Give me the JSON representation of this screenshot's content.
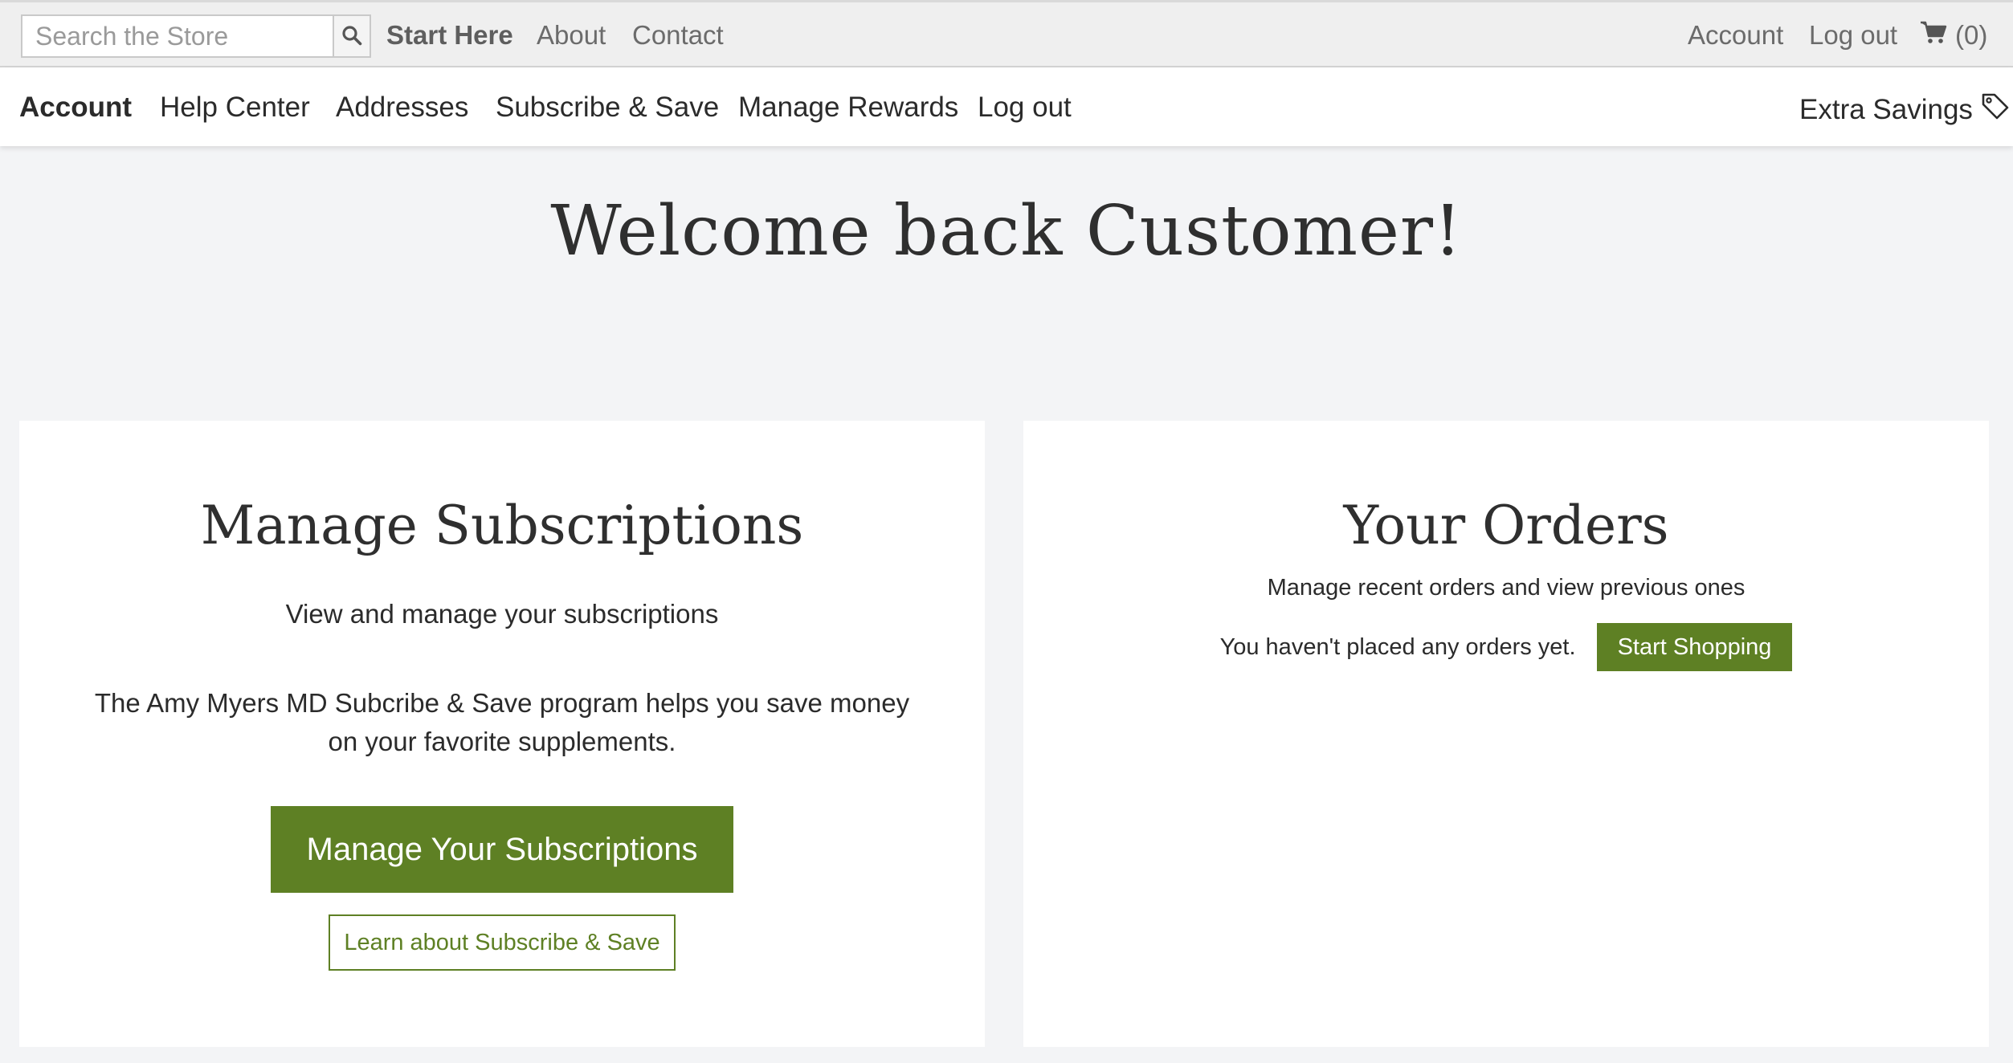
{
  "topbar": {
    "search_placeholder": "Search the Store",
    "search_icon": "search-icon",
    "links": {
      "start_here": "Start Here",
      "about": "About",
      "contact": "Contact",
      "account": "Account",
      "logout": "Log out"
    },
    "cart_icon": "cart-icon",
    "cart_count": "(0)"
  },
  "nav": {
    "items": [
      "Account",
      "Help Center",
      "Addresses",
      "Subscribe & Save",
      "Manage Rewards",
      "Log out"
    ],
    "active": "Account",
    "extra_savings": "Extra Savings",
    "extra_savings_icon": "tag-icon"
  },
  "main": {
    "welcome": "Welcome back Customer!"
  },
  "subscriptions": {
    "title": "Manage Subscriptions",
    "subtitle": "View and manage your subscriptions",
    "description": "The Amy Myers MD Subcribe & Save program helps you save money on your favorite supplements.",
    "primary_button": "Manage Your Subscriptions",
    "secondary_button": "Learn about Subscribe & Save"
  },
  "orders": {
    "title": "Your Orders",
    "subtitle": "Manage recent orders and view previous ones",
    "empty_text": "You haven't placed any orders yet.",
    "button": "Start Shopping"
  },
  "colors": {
    "accent_green": "#5e8024",
    "topbar_bg": "#efefef",
    "page_bg": "#f3f4f6"
  }
}
